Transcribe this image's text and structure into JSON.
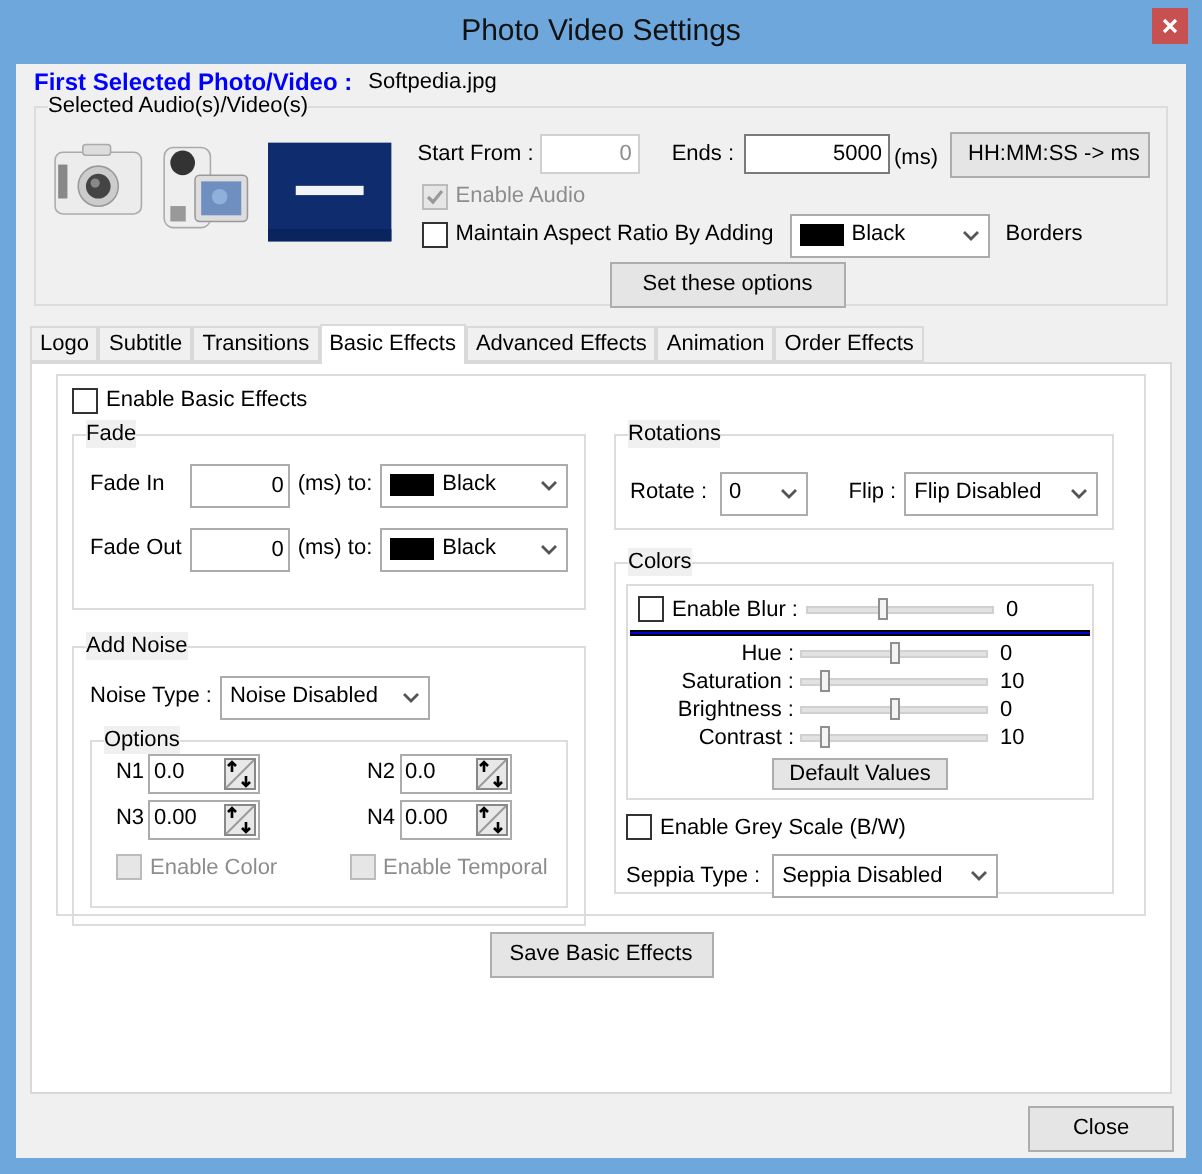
{
  "window": {
    "title": "Photo Video Settings"
  },
  "header": {
    "label": "First Selected Photo/Video :",
    "value": "Softpedia.jpg"
  },
  "media": {
    "title": "Selected Audio(s)/Video(s)",
    "start_from": {
      "label": "Start From :",
      "value": "0",
      "disabled": true
    },
    "ends": {
      "label": "Ends :",
      "value": "5000",
      "unit": "(ms)"
    },
    "convert_button": "HH:MM:SS -> ms",
    "enable_audio": {
      "label": "Enable Audio",
      "checked": true,
      "disabled": true
    },
    "aspect": {
      "label": "Maintain Aspect Ratio By Adding",
      "checked": false,
      "border_color": {
        "label": "Black",
        "color": "#000000"
      },
      "suffix": "Borders"
    },
    "set_button": "Set these options"
  },
  "tabs": [
    {
      "label": "Logo",
      "selected": false
    },
    {
      "label": "Subtitle",
      "selected": false
    },
    {
      "label": "Transitions",
      "selected": false
    },
    {
      "label": "Basic Effects",
      "selected": true
    },
    {
      "label": "Advanced Effects",
      "selected": false
    },
    {
      "label": "Animation",
      "selected": false
    },
    {
      "label": "Order Effects",
      "selected": false
    }
  ],
  "basic_effects": {
    "enable": {
      "label": "Enable Basic Effects",
      "checked": false
    },
    "fade": {
      "title": "Fade",
      "rows": [
        {
          "label": "Fade In",
          "value": "0",
          "unit": "(ms) to:",
          "color": {
            "label": "Black",
            "color": "#000000"
          }
        },
        {
          "label": "Fade Out",
          "value": "0",
          "unit": "(ms) to:",
          "color": {
            "label": "Black",
            "color": "#000000"
          }
        }
      ]
    },
    "noise": {
      "title": "Add Noise",
      "type_label": "Noise Type :",
      "type_value": "Noise Disabled",
      "options": {
        "title": "Options",
        "spinners": [
          {
            "label": "N1",
            "value": "0.0"
          },
          {
            "label": "N2",
            "value": "0.0"
          },
          {
            "label": "N3",
            "value": "0.00"
          },
          {
            "label": "N4",
            "value": "0.00"
          }
        ],
        "checkboxes": [
          {
            "label": "Enable Color",
            "checked": false,
            "disabled": true
          },
          {
            "label": "Enable Temporal",
            "checked": false,
            "disabled": true
          }
        ]
      }
    },
    "rotations": {
      "title": "Rotations",
      "rotate_label": "Rotate :",
      "rotate_value": "0",
      "flip_label": "Flip :",
      "flip_value": "Flip Disabled"
    },
    "colors": {
      "title": "Colors",
      "blur": {
        "label": "Enable Blur :",
        "checked": false,
        "level": 0.4,
        "reading": "0"
      },
      "sliders": [
        {
          "label": "Hue :",
          "level": 0.5,
          "reading": "0"
        },
        {
          "label": "Saturation :",
          "level": 0.1,
          "reading": "10"
        },
        {
          "label": "Brightness :",
          "level": 0.5,
          "reading": "0"
        },
        {
          "label": "Contrast :",
          "level": 0.1,
          "reading": "10"
        }
      ],
      "default_button": "Default Values",
      "grey_scale": {
        "label": "Enable Grey Scale (B/W)",
        "checked": false
      },
      "seppia_label": "Seppia Type :",
      "seppia_value": "Seppia Disabled"
    },
    "save_button": "Save Basic Effects"
  },
  "close_button": "Close"
}
